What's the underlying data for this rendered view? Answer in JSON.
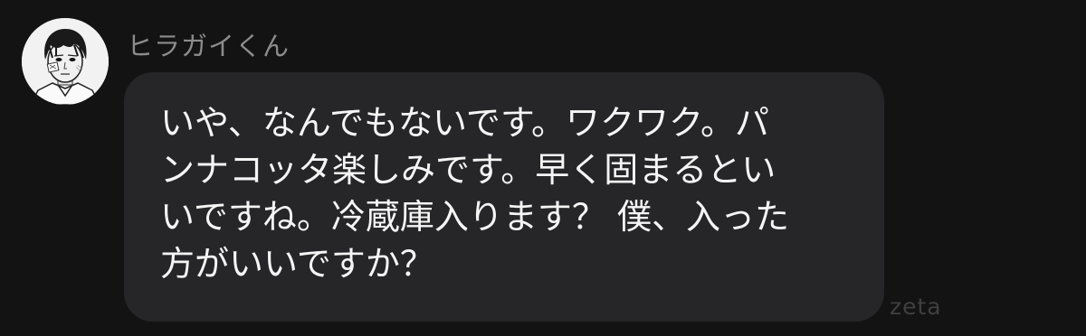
{
  "message": {
    "sender_name": "ヒラガイくん",
    "avatar_icon": "character-portrait-avatar",
    "lines": [
      "いや、なんでもないです。ワクワク。パ",
      "ンナコッタ楽しみです。早く固まるとい",
      "いですね。冷蔵庫入ります？ 僕、入った",
      "方がいいですか？"
    ]
  },
  "watermark": "zeta",
  "colors": {
    "background": "#131313",
    "bubble": "#262628",
    "message_text": "#f5f5f5",
    "sender_name": "#8c8c8c",
    "watermark": "#3f3f3f"
  }
}
